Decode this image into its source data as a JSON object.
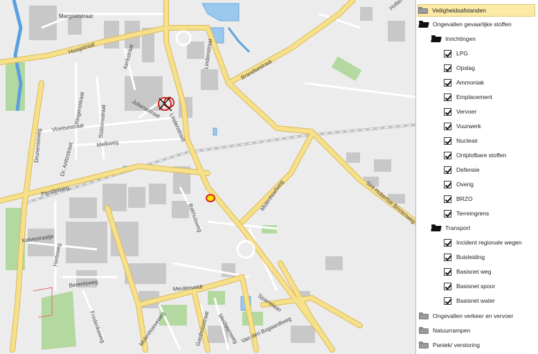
{
  "map": {
    "streets": [
      "Margrietstraat",
      "Hoogstraat",
      "Kerkstraat",
      "Julianastraat",
      "Lindenstraat",
      "Brandsestraat",
      "Ringersstraat",
      "Stationsstraat",
      "Dr. Anttzstraat",
      "Vloetsestraat",
      "Melkweg",
      "Drunenseweg",
      "Parallelweg",
      "Molenhoefweg",
      "Bakhuisweg",
      "Kalvestraatje",
      "Hertsweg",
      "Berentsweg",
      "Frederikeweg",
      "Meulenveldt",
      "Sparrelaan",
      "Molenhoeveweg",
      "Gasthuisstraat",
      "Meidoornweg",
      "Van den Bogaardtweg",
      "Sint Hubertse Binnenweg",
      "Hollandersteeg"
    ]
  },
  "layers": {
    "top": {
      "label": "Veiligheidsafstanden"
    },
    "group1": {
      "label": "Ongevallen gevaarlijke stoffen",
      "inrichtingen": {
        "label": "Inrichtingen",
        "items": [
          "LPG",
          "Opslag",
          "Ammoniak",
          "Emplacement",
          "Vervoer",
          "Vuurwerk",
          "Nucleair",
          "Ontplofbare stoffen",
          "Defensie",
          "Overig",
          "BRZO",
          "Terreingrens"
        ]
      },
      "transport": {
        "label": "Transport",
        "items": [
          "Incident regionale wegen",
          "Buisleiding",
          "Basisnet weg",
          "Basisnet spoor",
          "Basisnet water"
        ]
      }
    },
    "group2": {
      "label": "Ongevallen verkeer en vervoer"
    },
    "group3": {
      "label": "Natuurrampen"
    },
    "group4": {
      "label": "Paniek/ verstoring"
    }
  },
  "colors": {
    "road_main": "#f7e08a",
    "road_main_edge": "#d9b95a",
    "water": "#9ac8ee",
    "green": "#b4d9a0",
    "building": "#c8c8c8",
    "selected_bg": "#fbe9a6"
  }
}
